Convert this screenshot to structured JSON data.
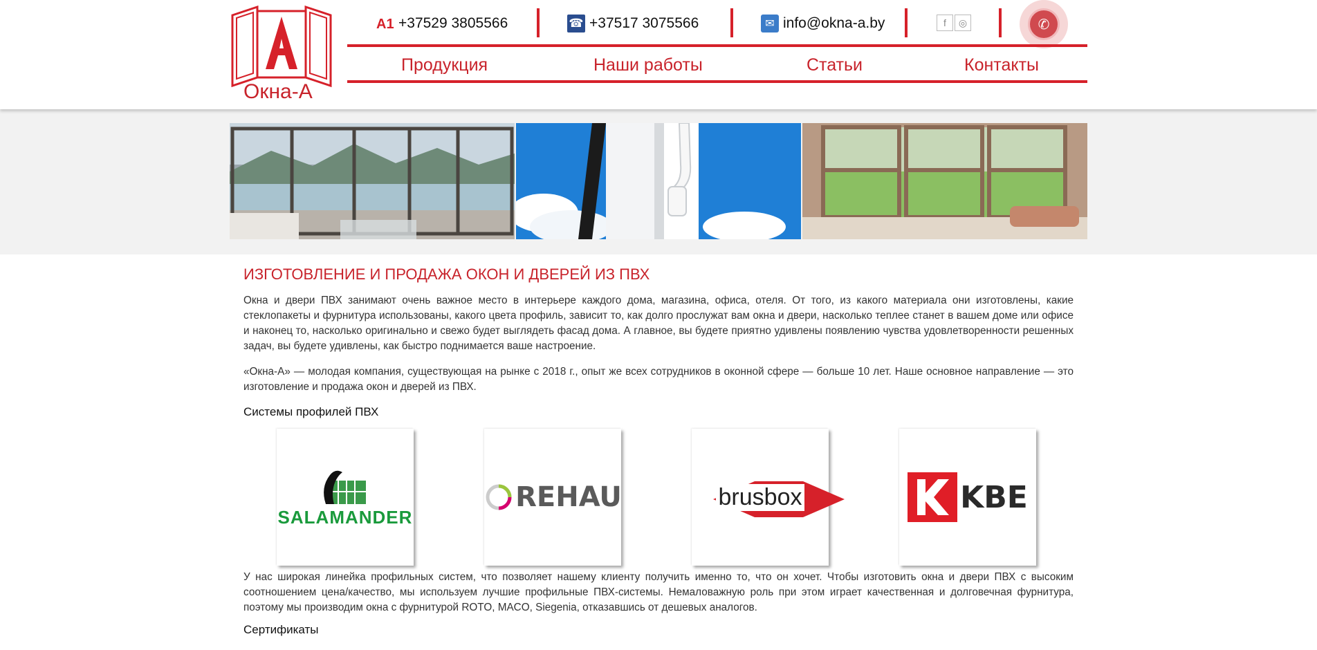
{
  "header": {
    "logo_text": "Окна-А",
    "logo_letter": "A",
    "phone1": "+37529 3805566",
    "phone1_icon_text": "A1",
    "phone2": "+37517 3075566",
    "email": "info@okna-a.by",
    "social": [
      {
        "icon": "facebook-icon",
        "glyph": "f"
      },
      {
        "icon": "instagram-icon",
        "glyph": "◎"
      }
    ],
    "call_icon": "phone-call-icon"
  },
  "nav": {
    "items": [
      {
        "label": "Продукция"
      },
      {
        "label": "Наши работы"
      },
      {
        "label": "Статьи"
      },
      {
        "label": "Контакты"
      }
    ]
  },
  "banner": {
    "images": [
      "sliding-glass-doors-lake-photo",
      "window-handle-sky-photo",
      "wooden-sash-windows-room-photo"
    ]
  },
  "main": {
    "title": "ИЗГОТОВЛЕНИЕ И ПРОДАЖА ОКОН И ДВЕРЕЙ ИЗ ПВХ",
    "p1": "Окна и двери ПВХ занимают очень важное место в интерьере каждого дома, магазина, офиса, отеля. От того, из какого материала они изготовлены, какие стеклопакеты и фурнитура использованы, какого цвета профиль, зависит то, как долго прослужат вам окна и двери, насколько теплее станет в вашем доме или офисе и наконец то, насколько оригинально и свежо будет выглядеть фасад дома. А главное, вы будете приятно удивлены появлению чувства удовлетворенности решенных задач, вы будете удивлены, как быстро поднимается ваше настроение.",
    "p2": "«Окна-А» — молодая компания, существующая на рынке с 2018 г., опыт же всех сотрудников в оконной сфере — больше 10 лет. Наше основное направление — это изготовление и продажа окон и дверей из ПВХ.",
    "profiles_heading": "Системы профилей ПВХ",
    "brands": [
      {
        "name": "SALAMANDER"
      },
      {
        "name": "REHAU"
      },
      {
        "name": "brusbox"
      },
      {
        "name": "KBE"
      }
    ],
    "p3": "У нас широкая линейка профильных систем, что позволяет нашему клиенту получить именно то, что он хочет. Чтобы изготовить окна и двери ПВХ с высоким соотношением цена/качество, мы используем лучшие профильные ПВХ-системы. Немаловажную роль при этом играет качественная и долговечная фурнитура, поэтому мы производим окна с фурнитурой ROTO, MACO, Siegenia, отказавшись от дешевых аналогов.",
    "certs_heading": "Сертификаты"
  },
  "colors": {
    "accent": "#d6212a",
    "nav_text": "#c8232b",
    "banner_bg": "#f2f2f2"
  }
}
